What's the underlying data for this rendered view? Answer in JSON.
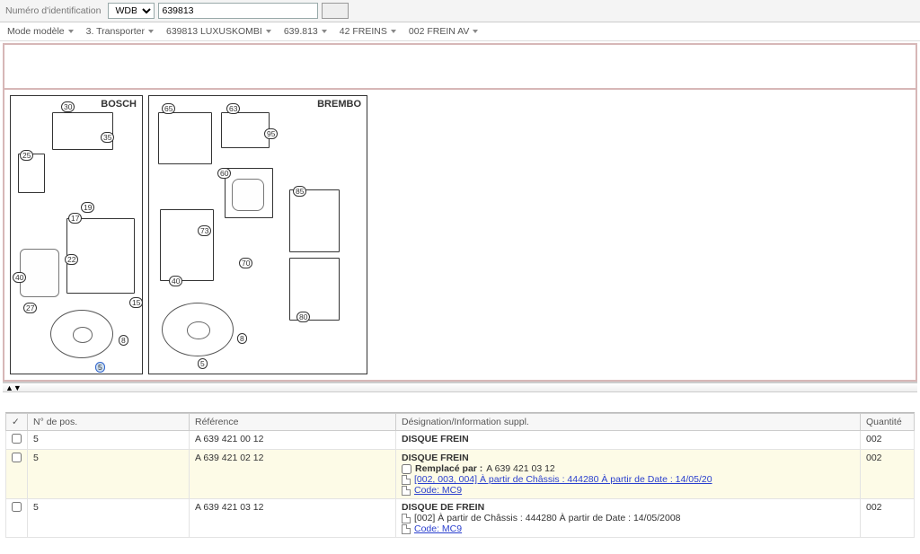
{
  "identBar": {
    "label": "Numéro d'identification",
    "selectValue": "WDB",
    "inputValue": "639813"
  },
  "breadcrumbs": [
    "Mode modèle",
    "3. Transporter",
    "639813 LUXUSKOMBI",
    "639.813",
    "42 FREINS",
    "002 FREIN AV"
  ],
  "diagram": {
    "panelA": {
      "title": "BOSCH",
      "callouts": [
        "30",
        "35",
        "25",
        "19",
        "17",
        "22",
        "40",
        "27",
        "15",
        "8",
        "5"
      ]
    },
    "panelB": {
      "title": "BREMBO",
      "callouts": [
        "65",
        "63",
        "95",
        "60",
        "73",
        "85",
        "70",
        "40",
        "80",
        "8",
        "5"
      ]
    }
  },
  "splitterGlyph": "▲▼",
  "table": {
    "headers": {
      "chk": "✓",
      "pos": "N° de pos.",
      "ref": "Référence",
      "des": "Désignation/Information suppl.",
      "qty": "Quantité"
    },
    "rows": [
      {
        "pos": "5",
        "ref": "A 639 421 00 12",
        "title": "DISQUE FREIN",
        "qty": "002",
        "highlight": false,
        "lines": []
      },
      {
        "pos": "5",
        "ref": "A 639 421 02 12",
        "title": "DISQUE FREIN",
        "qty": "002",
        "highlight": true,
        "replacedBy": "A 639 421 03 12",
        "replacedLabel": "Remplacé par :",
        "lines": [
          {
            "link": true,
            "text": "[002, 003, 004] À partir de Châssis : 444280 À partir de Date : 14/05/20"
          },
          {
            "link": true,
            "text": "Code: MC9"
          }
        ]
      },
      {
        "pos": "5",
        "ref": "A 639 421 03 12",
        "title": "DISQUE DE FREIN",
        "qty": "002",
        "highlight": false,
        "lines": [
          {
            "link": false,
            "text": "[002]   À partir de Châssis :   444280  À partir de Date : 14/05/2008"
          },
          {
            "link": true,
            "text": "Code: MC9"
          }
        ]
      }
    ]
  }
}
